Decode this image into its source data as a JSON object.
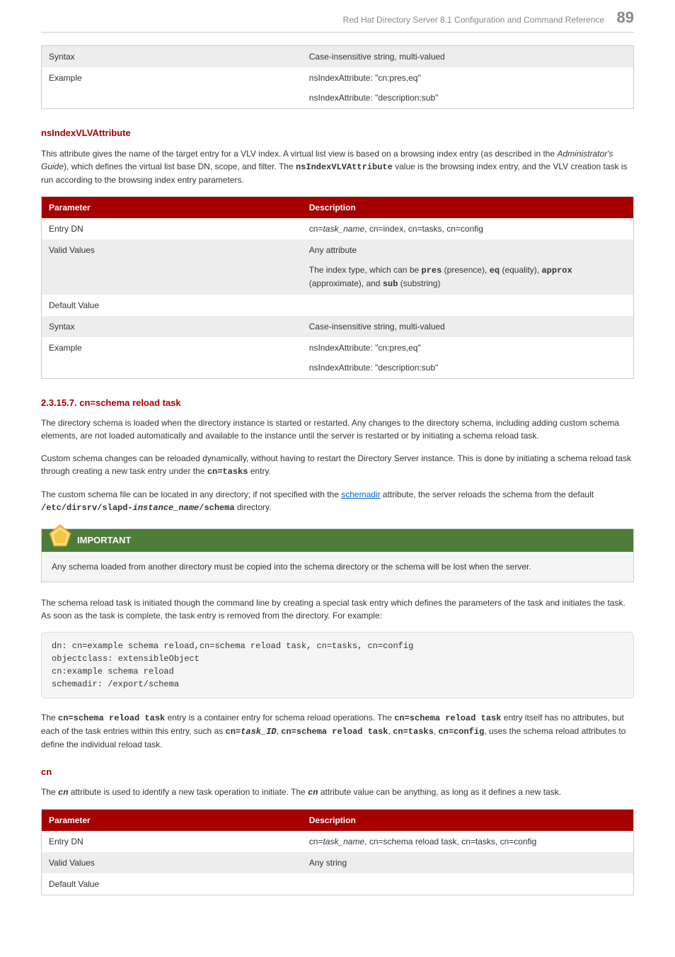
{
  "header": {
    "title": "Red Hat Directory Server 8.1 Configuration and Command Reference",
    "page_number": "89"
  },
  "table1": {
    "rows": [
      {
        "param": "Syntax",
        "desc": "Case-insensitive string, multi-valued",
        "shade": true
      },
      {
        "param": "Example",
        "desc_lines": [
          "nsIndexAttribute: \"cn:pres,eq\"",
          "nsIndexAttribute: \"description:sub\""
        ],
        "shade": false
      }
    ]
  },
  "section_vlv": {
    "heading": "nsIndexVLVAttribute",
    "p1_pre": "This attribute gives the name of the target entry for a VLV index. A virtual list view is based on a browsing index entry (as described in the ",
    "p1_em": "Administrator's Guide",
    "p1_mid": "), which defines the virtual list base DN, scope, and filter. The ",
    "p1_code": "nsIndexVLVAttribute",
    "p1_post": " value is the browsing index entry, and the VLV creation task is run according to the browsing index entry parameters."
  },
  "table2": {
    "head_param": "Parameter",
    "head_desc": "Description",
    "entry_dn_label": "Entry DN",
    "entry_dn_pre": "cn=",
    "entry_dn_em": "task_name",
    "entry_dn_post": ", cn=index, cn=tasks, cn=config",
    "valid_values_label": "Valid Values",
    "valid_values_p1": "Any attribute",
    "valid_values_p2_a": "The index type, which can be ",
    "valid_values_pres": "pres",
    "valid_values_p2_b": " (presence), ",
    "valid_values_eq": "eq",
    "valid_values_p2_c": " (equality), ",
    "valid_values_approx": "approx",
    "valid_values_p2_d": " (approximate), and ",
    "valid_values_sub": "sub",
    "valid_values_p2_e": " (substring)",
    "default_value_label": "Default Value",
    "syntax_label": "Syntax",
    "syntax_desc": "Case-insensitive string, multi-valued",
    "example_label": "Example",
    "example_l1": "nsIndexAttribute: \"cn:pres,eq\"",
    "example_l2": "nsIndexAttribute: \"description:sub\""
  },
  "section_reload": {
    "heading": "2.3.15.7. cn=schema reload task",
    "p1": "The directory schema is loaded when the directory instance is started or restarted. Any changes to the directory schema, including adding custom schema elements, are not loaded automatically and available to the instance until the server is restarted or by initiating a schema reload task.",
    "p2_a": "Custom schema changes can be reloaded dynamically, without having to restart the Directory Server instance. This is done by initiating a schema reload task through creating a new task entry under the ",
    "p2_code": "cn=tasks",
    "p2_b": " entry.",
    "p3_a": "The custom schema file can be located in any directory; if not specified with the ",
    "p3_link": "schemadir",
    "p3_b": " attribute, the server reloads the schema from the default ",
    "p3_code1": "/etc/dirsrv/slapd-",
    "p3_em": "instance_name",
    "p3_code2": "/schema",
    "p3_c": " directory."
  },
  "admon": {
    "title": "IMPORTANT",
    "body": "Any schema loaded from another directory must be copied into the schema directory or the schema will be lost when the server."
  },
  "post_admon": {
    "p1": "The schema reload task is initiated though the command line by creating a special task entry which defines the parameters of the task and initiates the task. As soon as the task is complete, the task entry is removed from the directory. For example:",
    "code": "dn: cn=example schema reload,cn=schema reload task, cn=tasks, cn=config\nobjectclass: extensibleObject\ncn:example schema reload\nschemadir: /export/schema",
    "p2_a": "The ",
    "p2_c1": "cn=schema reload task",
    "p2_b": " entry is a container entry for schema reload operations. The ",
    "p2_c2": "cn=schema reload task",
    "p2_c": " entry itself has no attributes, but each of the task entries within this entry, such as ",
    "p2_c3a": "cn=",
    "p2_c3em": "task_ID",
    "p2_c3b": ", ",
    "p2_c4": "cn=schema reload task",
    "p2_c4b": ", ",
    "p2_c5": "cn=tasks",
    "p2_c5b": ", ",
    "p2_c6": "cn=config",
    "p2_d": ", uses the schema reload attributes to define the individual reload task."
  },
  "section_cn": {
    "heading": "cn",
    "p1_a": "The ",
    "p1_c1": "cn",
    "p1_b": " attribute is used to identify a new task operation to initiate. The ",
    "p1_c2": "cn",
    "p1_c": " attribute value can be anything, as long as it defines a new task."
  },
  "table3": {
    "head_param": "Parameter",
    "head_desc": "Description",
    "entry_dn_label": "Entry DN",
    "entry_dn_pre": "cn=",
    "entry_dn_em": "task_name",
    "entry_dn_post": ", cn=schema reload task, cn=tasks, cn=config",
    "valid_values_label": "Valid Values",
    "valid_values_desc": "Any string",
    "default_value_label": "Default Value"
  }
}
